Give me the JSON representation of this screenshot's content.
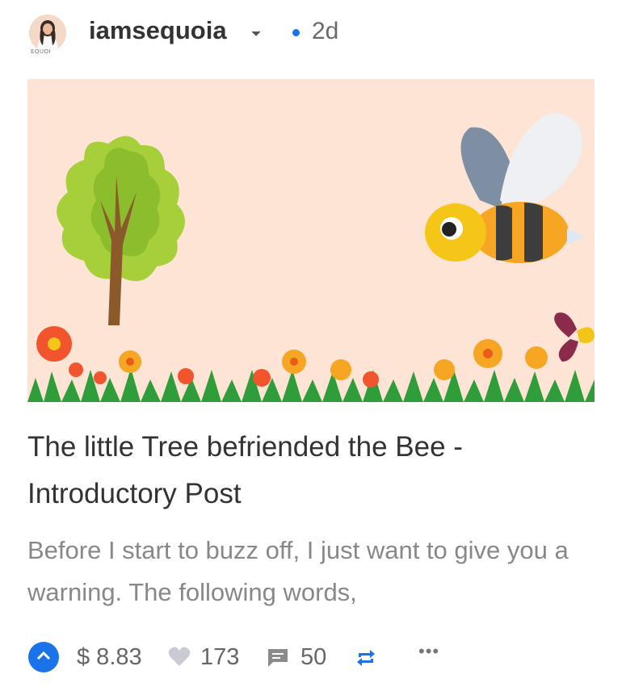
{
  "post": {
    "author": "iamsequoia",
    "avatar_label": "EQUOI",
    "age": "2d",
    "title": "The little Tree befriended the Bee - Introductory Post",
    "excerpt": "Before I start to buzz off, I just want to give you a warning. The following words,",
    "payout": "$ 8.83",
    "votes": "173",
    "comments": "50"
  },
  "icons": {
    "upvote": "chevron-up-icon",
    "heart": "heart-icon",
    "comment": "comment-icon",
    "reblog": "reblog-icon",
    "more": "more-icon",
    "dropdown": "chevron-down-icon"
  },
  "colors": {
    "accent": "#1a73e8",
    "banner_bg": "#fde4d4",
    "text": "#333333",
    "muted": "#888888"
  }
}
